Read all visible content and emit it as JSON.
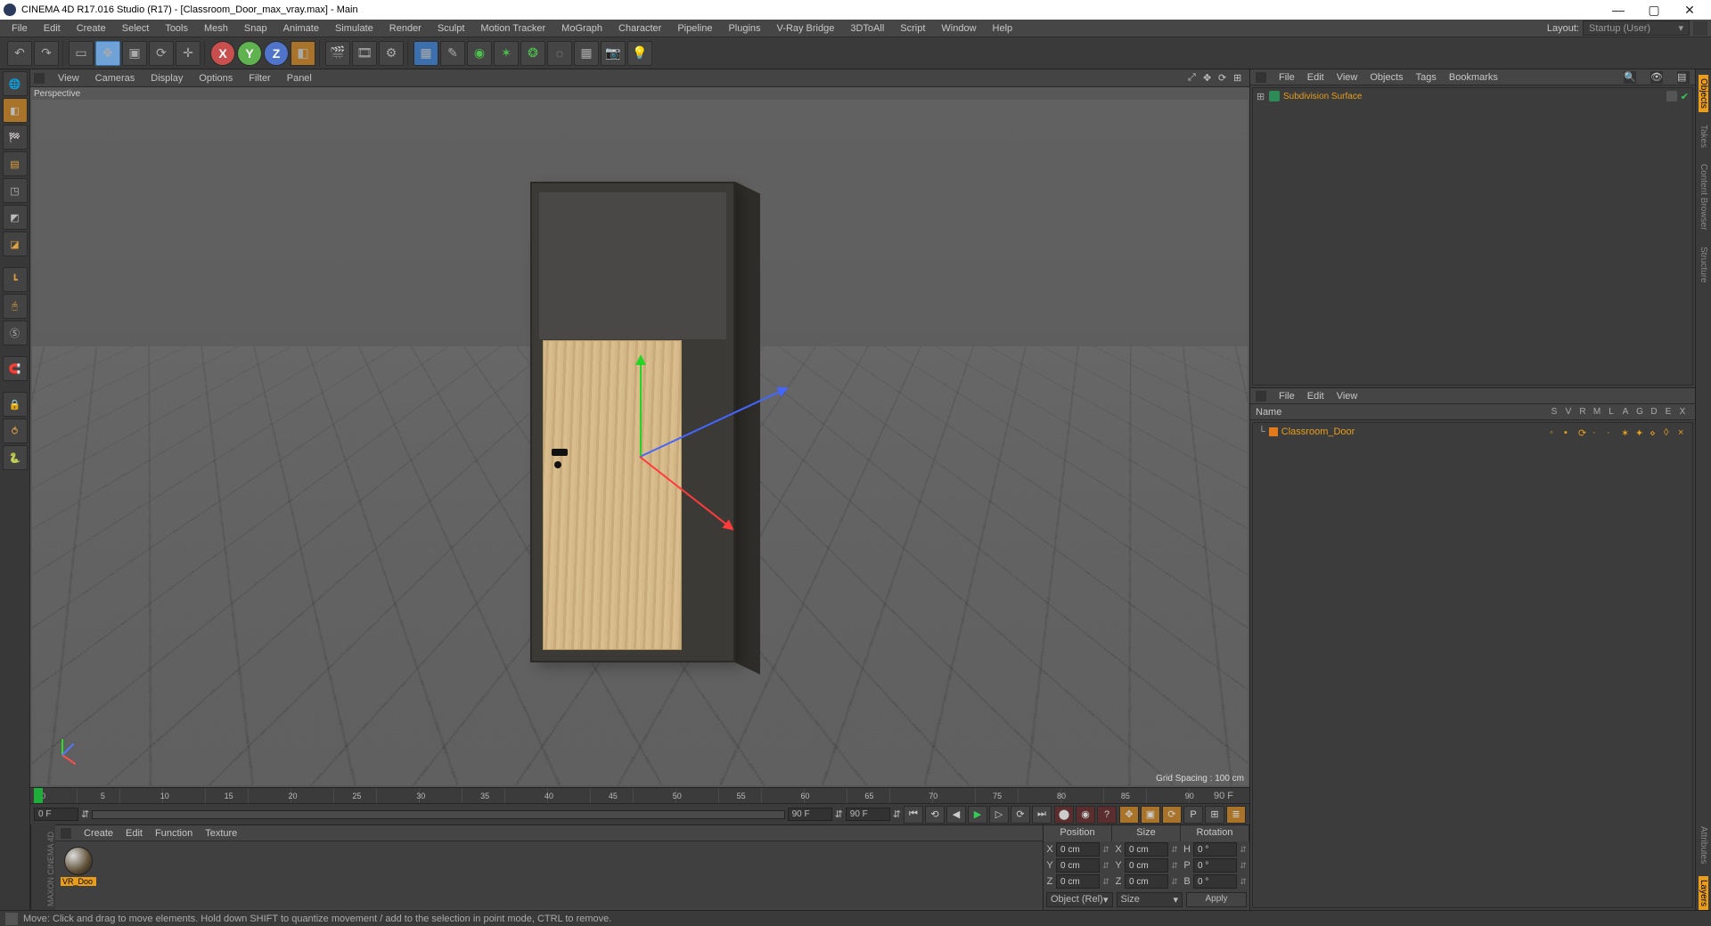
{
  "title": "CINEMA 4D R17.016 Studio (R17) - [Classroom_Door_max_vray.max] - Main",
  "menubar": [
    "File",
    "Edit",
    "Create",
    "Select",
    "Tools",
    "Mesh",
    "Snap",
    "Animate",
    "Simulate",
    "Render",
    "Sculpt",
    "Motion Tracker",
    "MoGraph",
    "Character",
    "Pipeline",
    "Plugins",
    "V-Ray Bridge",
    "3DToAll",
    "Script",
    "Window",
    "Help"
  ],
  "layout": {
    "label": "Layout:",
    "value": "Startup (User)"
  },
  "vpmenu": [
    "View",
    "Cameras",
    "Display",
    "Options",
    "Filter",
    "Panel"
  ],
  "viewport": {
    "label": "Perspective",
    "grid_spacing": "Grid Spacing : 100 cm"
  },
  "timeline": {
    "ticks": [
      "0",
      "5",
      "10",
      "15",
      "20",
      "25",
      "30",
      "35",
      "40",
      "45",
      "50",
      "55",
      "60",
      "65",
      "70",
      "75",
      "80",
      "85",
      "90"
    ],
    "end_label": "90 F",
    "start": "0 F",
    "slider": "0 F",
    "max": "90 F",
    "cur": "90 F"
  },
  "material_panel": {
    "menu": [
      "Create",
      "Edit",
      "Function",
      "Texture"
    ],
    "material": {
      "name": "VR_Doo"
    }
  },
  "coords": {
    "headers": [
      "Position",
      "Size",
      "Rotation"
    ],
    "rows": [
      {
        "axis": "X",
        "pos": "0 cm",
        "size": "0 cm",
        "rotlabel": "H",
        "rot": "0 °"
      },
      {
        "axis": "Y",
        "pos": "0 cm",
        "size": "0 cm",
        "rotlabel": "P",
        "rot": "0 °"
      },
      {
        "axis": "Z",
        "pos": "0 cm",
        "size": "0 cm",
        "rotlabel": "B",
        "rot": "0 °"
      }
    ],
    "mode": "Object (Rel)",
    "sizeMode": "Size",
    "apply": "Apply"
  },
  "objects_panel": {
    "menu": [
      "File",
      "Edit",
      "View",
      "Objects",
      "Tags",
      "Bookmarks"
    ],
    "item": {
      "name": "Subdivision Surface"
    }
  },
  "attr_panel": {
    "menu": [
      "File",
      "Edit",
      "View"
    ],
    "head": "Name",
    "cols": [
      "S",
      "V",
      "R",
      "M",
      "L",
      "A",
      "G",
      "D",
      "E",
      "X"
    ],
    "item": "Classroom_Door"
  },
  "right_tabs": [
    "Objects",
    "Takes",
    "Content Browser",
    "Structure",
    "Attributes",
    "Layers"
  ],
  "status": {
    "text": "Move: Click and drag to move elements. Hold down SHIFT to quantize movement / add to the selection in point mode, CTRL to remove."
  },
  "maxon": "MAXON  CINEMA 4D"
}
